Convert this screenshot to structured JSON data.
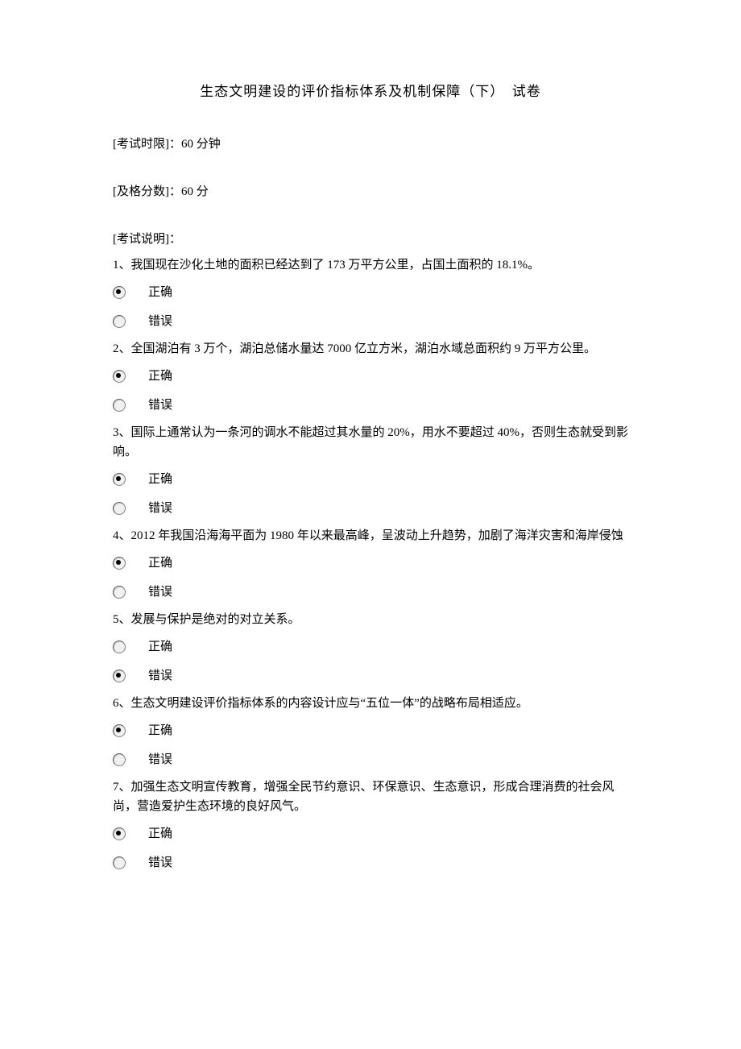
{
  "title": "生态文明建设的评价指标体系及机制保障（下）　试卷",
  "meta": {
    "time": "[考试时限]：60 分钟",
    "pass": "[及格分数]：60 分",
    "desc": "[考试说明]："
  },
  "labels": {
    "true": "正确",
    "false": "错误"
  },
  "questions": [
    {
      "text": "1、我国现在沙化土地的面积已经达到了 173 万平方公里，占国土面积的 18.1%。",
      "selected": "true"
    },
    {
      "text": "2、全国湖泊有 3 万个，湖泊总储水量达 7000 亿立方米，湖泊水域总面积约 9 万平方公里。",
      "selected": "true"
    },
    {
      "text": "3、国际上通常认为一条河的调水不能超过其水量的 20%，用水不要超过 40%，否则生态就受到影响。",
      "selected": "true"
    },
    {
      "text": "4、2012 年我国沿海海平面为 1980 年以来最高峰，呈波动上升趋势，加剧了海洋灾害和海岸侵蚀",
      "selected": "true"
    },
    {
      "text": "5、发展与保护是绝对的对立关系。",
      "selected": "false"
    },
    {
      "text": "6、生态文明建设评价指标体系的内容设计应与“五位一体”的战略布局相适应。",
      "selected": "true"
    },
    {
      "text": "7、加强生态文明宣传教育，增强全民节约意识、环保意识、生态意识，形成合理消费的社会风尚，营造爱护生态环境的良好风气。",
      "selected": "true"
    }
  ]
}
